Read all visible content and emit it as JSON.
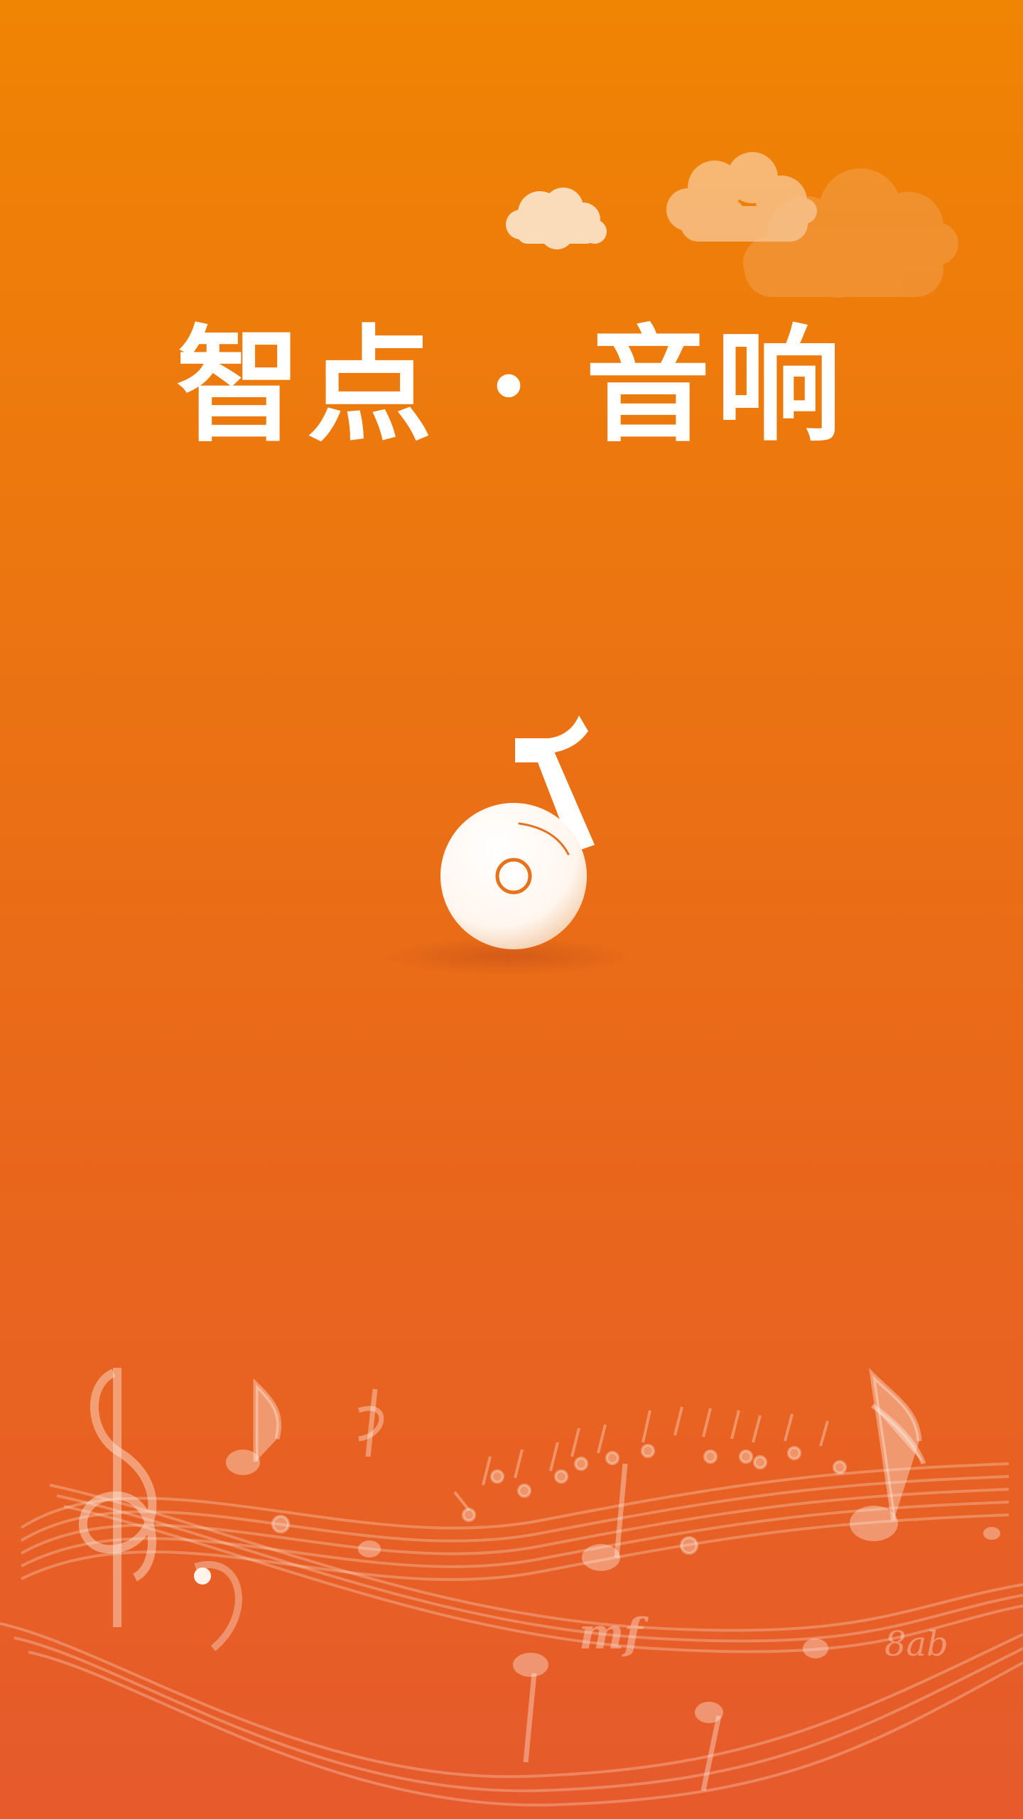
{
  "app": {
    "title": "智点 · 音响"
  },
  "decor": {
    "dynamic_mark": "mf",
    "chord_text": "8ab"
  },
  "colors": {
    "background_top": "#f08403",
    "background_bottom": "#e65a2c",
    "title": "#ffffff",
    "logo": "#ffffff",
    "logo_accent": "#e8711c",
    "cloud": "#f7c697"
  },
  "icons": {
    "logo": "music-note-disc-icon",
    "clouds": "cloud-icon",
    "staff": "music-staff-icon"
  }
}
